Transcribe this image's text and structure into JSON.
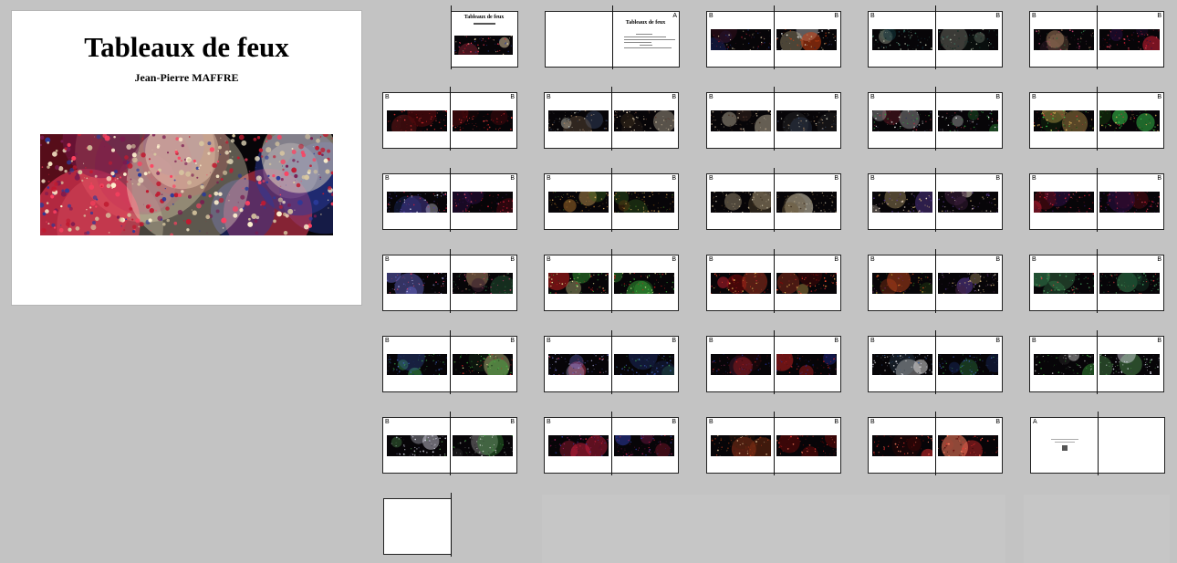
{
  "cover": {
    "title": "Tableaux de feux",
    "author": "Jean-Pierre MAFFRE"
  },
  "title_page": {
    "title": "Tableaux de feux",
    "label_right": "A"
  },
  "end_page": {
    "label_left": "A"
  },
  "palettes": [
    [
      "#3b1020",
      "#9e1b2c",
      "#d8c7a0",
      "#1c2d7a"
    ],
    [
      "#2a2a4a",
      "#c7b88a",
      "#d04010",
      "#ffffff"
    ],
    [
      "#0e2a20",
      "#3f7a66",
      "#cfd8c0",
      "#12303a"
    ],
    [
      "#3a2030",
      "#a88060",
      "#c04070",
      "#2b6a40"
    ],
    [
      "#6a0a10",
      "#d42a2a",
      "#ff4a4a",
      "#2a0505"
    ],
    [
      "#2b2b2b",
      "#a08060",
      "#d0d0c0",
      "#3a4a6a"
    ],
    [
      "#403020",
      "#d8c0a0",
      "#fff0d0",
      "#5a3a30"
    ],
    [
      "#3a3a5a",
      "#e0e0e0",
      "#30a040",
      "#b03040"
    ],
    [
      "#1a4a10",
      "#3ad050",
      "#e03040",
      "#f0c060"
    ],
    [
      "#203070",
      "#e0e0f0",
      "#c02040",
      "#5040a0"
    ],
    [
      "#5a3a10",
      "#a06a2a",
      "#e0b060",
      "#3a6a20"
    ],
    [
      "#3a2a1a",
      "#b0a080",
      "#6a5a3a",
      "#e0d8c0"
    ],
    [
      "#402040",
      "#f0e0d0",
      "#e0c080",
      "#6040a0"
    ],
    [
      "#600a14",
      "#e0203a",
      "#30104a",
      "#f05a6a"
    ],
    [
      "#2a2a6a",
      "#b0b0e0",
      "#e04060",
      "#6a6ad0"
    ],
    [
      "#1a3a1a",
      "#d02020",
      "#40c040",
      "#f0f0a0"
    ],
    [
      "#7a0a0a",
      "#ff5030",
      "#ffd060",
      "#c02030"
    ],
    [
      "#3a6a20",
      "#e05020",
      "#6a2a60",
      "#c0a030"
    ],
    [
      "#1a4a30",
      "#50a060",
      "#d04040",
      "#40a060"
    ],
    [
      "#1a2a60",
      "#4060c0",
      "#3aa050",
      "#203050"
    ],
    [
      "#3a0a10",
      "#c02020",
      "#2030a0",
      "#602040"
    ],
    [
      "#203040",
      "#c0c0d0",
      "#3060b0",
      "#e0e0e0"
    ],
    [
      "#2a2a2a",
      "#f0f0f0",
      "#3aa03a",
      "#a0a0a0"
    ],
    [
      "#3a3a50",
      "#e0e0f0",
      "#4a8a4a",
      "#f0f0ff"
    ],
    [
      "#4a0a30",
      "#d02040",
      "#3040b0",
      "#a02060"
    ],
    [
      "#3a2010",
      "#f0d0a0",
      "#c04020",
      "#803010"
    ],
    [
      "#6a0a0a",
      "#f03030",
      "#ff8060",
      "#3a0505"
    ]
  ],
  "spreads": [
    {
      "l": "B",
      "r": "B",
      "pl": 0,
      "pr": 1
    },
    {
      "l": "B",
      "r": "B",
      "pl": 2,
      "pr": 2
    },
    {
      "l": "B",
      "r": "B",
      "pl": 3,
      "pr": 13
    },
    {
      "l": "B",
      "r": "B",
      "pl": 4,
      "pr": 4
    },
    {
      "l": "B",
      "r": "B",
      "pl": 5,
      "pr": 6
    },
    {
      "l": "B",
      "r": "B",
      "pl": 6,
      "pr": 5
    },
    {
      "l": "B",
      "r": "B",
      "pl": 7,
      "pr": 7
    },
    {
      "l": "B",
      "r": "B",
      "pl": 8,
      "pr": 8
    },
    {
      "l": "B",
      "r": "B",
      "pl": 9,
      "pr": 13
    },
    {
      "l": "B",
      "r": "B",
      "pl": 10,
      "pr": 10
    },
    {
      "l": "B",
      "r": "B",
      "pl": 11,
      "pr": 11
    },
    {
      "l": "B",
      "r": "B",
      "pl": 12,
      "pr": 12
    },
    {
      "l": "B",
      "r": "B",
      "pl": 13,
      "pr": 13
    },
    {
      "l": "B",
      "r": "B",
      "pl": 14,
      "pr": 3
    },
    {
      "l": "B",
      "r": "B",
      "pl": 15,
      "pr": 15
    },
    {
      "l": "B",
      "r": "B",
      "pl": 16,
      "pr": 16
    },
    {
      "l": "B",
      "r": "B",
      "pl": 17,
      "pr": 12
    },
    {
      "l": "B",
      "r": "B",
      "pl": 18,
      "pr": 18
    },
    {
      "l": "B",
      "r": "B",
      "pl": 19,
      "pr": 15
    },
    {
      "l": "B",
      "r": "B",
      "pl": 14,
      "pr": 19
    },
    {
      "l": "B",
      "r": "B",
      "pl": 20,
      "pr": 20
    },
    {
      "l": "B",
      "r": "B",
      "pl": 21,
      "pr": 19
    },
    {
      "l": "B",
      "r": "B",
      "pl": 22,
      "pr": 23
    },
    {
      "l": "B",
      "r": "B",
      "pl": 23,
      "pr": 22
    },
    {
      "l": "B",
      "r": "B",
      "pl": 24,
      "pr": 24
    },
    {
      "l": "B",
      "r": "B",
      "pl": 25,
      "pr": 26
    },
    {
      "l": "B",
      "r": "B",
      "pl": 26,
      "pr": 26
    }
  ]
}
